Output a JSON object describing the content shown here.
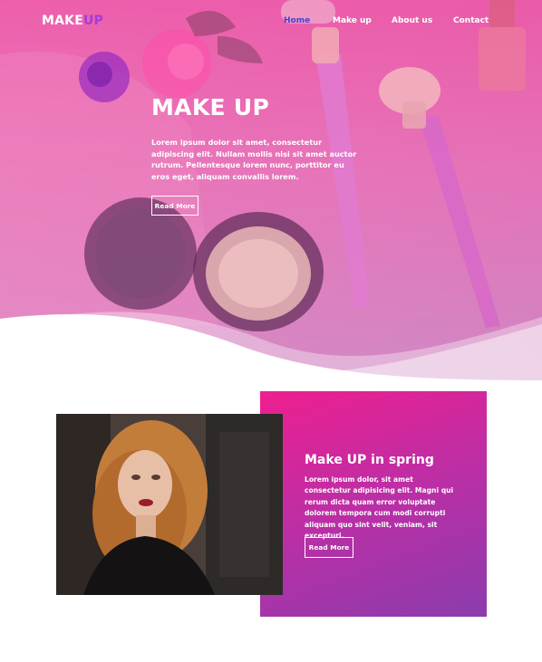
{
  "nav": {
    "logo_main": "MAKE",
    "logo_accent": "UP",
    "items": [
      {
        "label": "Home",
        "active": true
      },
      {
        "label": "Make up",
        "active": false
      },
      {
        "label": "About us",
        "active": false
      },
      {
        "label": "Contact",
        "active": false
      }
    ]
  },
  "hero": {
    "title": "MAKE UP",
    "text": "Lorem ipsum dolor sit amet, consectetur adipiscing elit. Nullam mollis nisi sit amet auctor rutrum. Pellentesque lorem nunc, porttitor eu eros eget, aliquam convallis lorem.",
    "button": "Read More"
  },
  "feature": {
    "title": "Make UP in spring",
    "text": "Lorem ipsum dolor, sit amet consectetur adipisicing elit. Magni qui rerum dicta quam error voluptate dolorem tempora cum modi corrupti aliquam quo sint velit, veniam, sit excepturi.",
    "button": "Read More"
  },
  "colors": {
    "hero_pink": "#ec48a0",
    "nav_active": "#4b3fd0",
    "logo_accent": "#a13bdb",
    "panel_start": "#ee1f8f",
    "panel_end": "#8b3cad"
  }
}
